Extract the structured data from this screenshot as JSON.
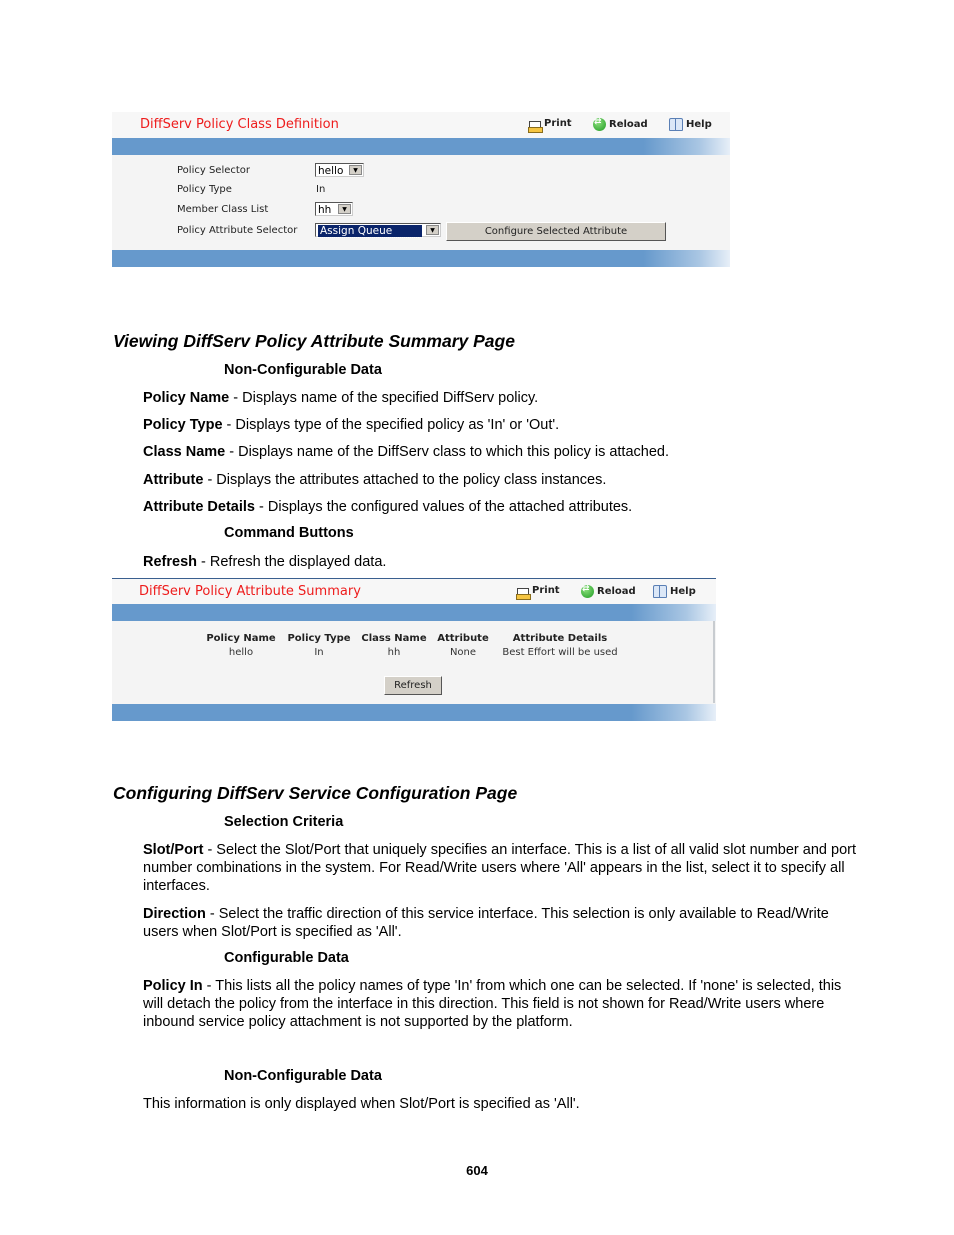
{
  "panel1": {
    "title": "DiffServ Policy Class Definition",
    "toolbar": {
      "print": "Print",
      "reload": "Reload",
      "help": "Help"
    },
    "fields": [
      {
        "label": "Policy Selector",
        "value": "hello",
        "type": "select"
      },
      {
        "label": "Policy Type",
        "value": "In",
        "type": "text"
      },
      {
        "label": "Member Class List",
        "value": "hh",
        "type": "select"
      },
      {
        "label": "Policy Attribute Selector",
        "value": "Assign Queue",
        "type": "select"
      }
    ],
    "configure_button": "Configure Selected Attribute"
  },
  "section1": {
    "heading": "Viewing DiffServ Policy Attribute Summary Page",
    "sub1": "Non-Configurable Data",
    "items": [
      {
        "term": "Policy Name",
        "desc": " - Displays name of the specified DiffServ policy."
      },
      {
        "term": "Policy Type",
        "desc": " - Displays type of the specified policy as 'In' or 'Out'."
      },
      {
        "term": "Class Name",
        "desc": " - Displays name of the DiffServ class to which this policy is attached."
      },
      {
        "term": "Attribute",
        "desc": " - Displays the attributes attached to the policy class instances."
      },
      {
        "term": "Attribute Details",
        "desc": " - Displays the configured values of the attached attributes."
      }
    ],
    "sub2": "Command Buttons",
    "button_items": [
      {
        "term": "Refresh",
        "desc": " - Refresh the displayed data."
      }
    ]
  },
  "panel2": {
    "title": "DiffServ Policy Attribute Summary",
    "toolbar": {
      "print": "Print",
      "reload": "Reload",
      "help": "Help"
    },
    "columns": [
      "Policy Name",
      "Policy Type",
      "Class Name",
      "Attribute",
      "Attribute Details"
    ],
    "row": [
      "hello",
      "In",
      "hh",
      "None",
      "Best Effort will be used"
    ],
    "refresh_button": "Refresh"
  },
  "section2": {
    "heading": "Configuring DiffServ Service Configuration Page",
    "sub1": "Selection Criteria",
    "slot_port": {
      "term": "Slot/Port",
      "desc": " - Select the Slot/Port that uniquely specifies an interface. This is a list of all valid slot number and port number combinations in the system. For Read/Write users where 'All' appears in the list, select it to specify all interfaces."
    },
    "direction": {
      "term": "Direction",
      "desc": " - Select the traffic direction of this service interface. This selection is only available to Read/Write users when Slot/Port is specified as 'All'."
    },
    "sub2": "Configurable Data",
    "policy_in": {
      "term": "Policy In",
      "desc": " - This lists all the policy names of type 'In' from which one can be selected. If 'none' is selected, this will detach the policy from the interface in this direction. This field is not shown for Read/Write users where inbound service policy attachment is not supported by the platform."
    },
    "sub3": "Non-Configurable Data",
    "note": "This information is only displayed when Slot/Port is specified as 'All'."
  },
  "page_number": "604"
}
